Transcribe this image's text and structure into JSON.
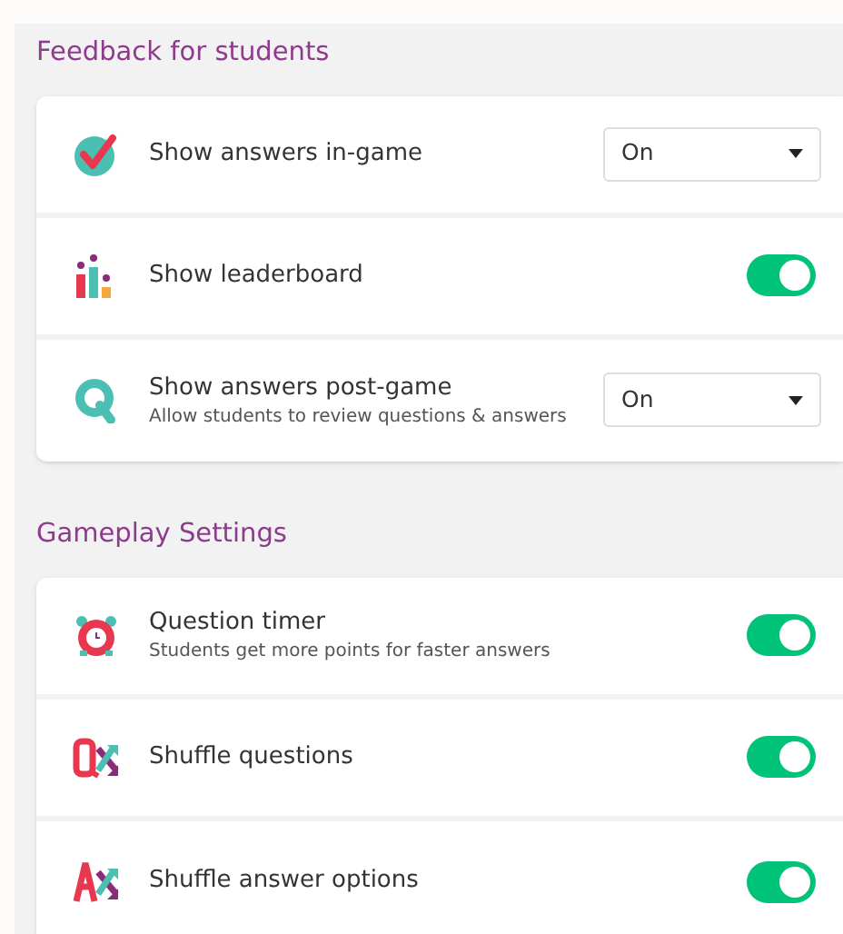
{
  "sections": [
    {
      "title": "Feedback for students",
      "rows": [
        {
          "label": "Show answers in-game",
          "kind": "dropdown",
          "value": "On"
        },
        {
          "label": "Show leaderboard",
          "kind": "toggle",
          "on": true
        },
        {
          "label": "Show answers post-game",
          "description": "Allow students to review questions & answers",
          "kind": "dropdown",
          "value": "On"
        }
      ]
    },
    {
      "title": "Gameplay Settings",
      "rows": [
        {
          "label": "Question timer",
          "description": "Students get more points for faster answers",
          "kind": "toggle",
          "on": true
        },
        {
          "label": "Shuffle questions",
          "kind": "toggle",
          "on": true
        },
        {
          "label": "Shuffle answer options",
          "kind": "toggle",
          "on": true
        }
      ]
    }
  ]
}
